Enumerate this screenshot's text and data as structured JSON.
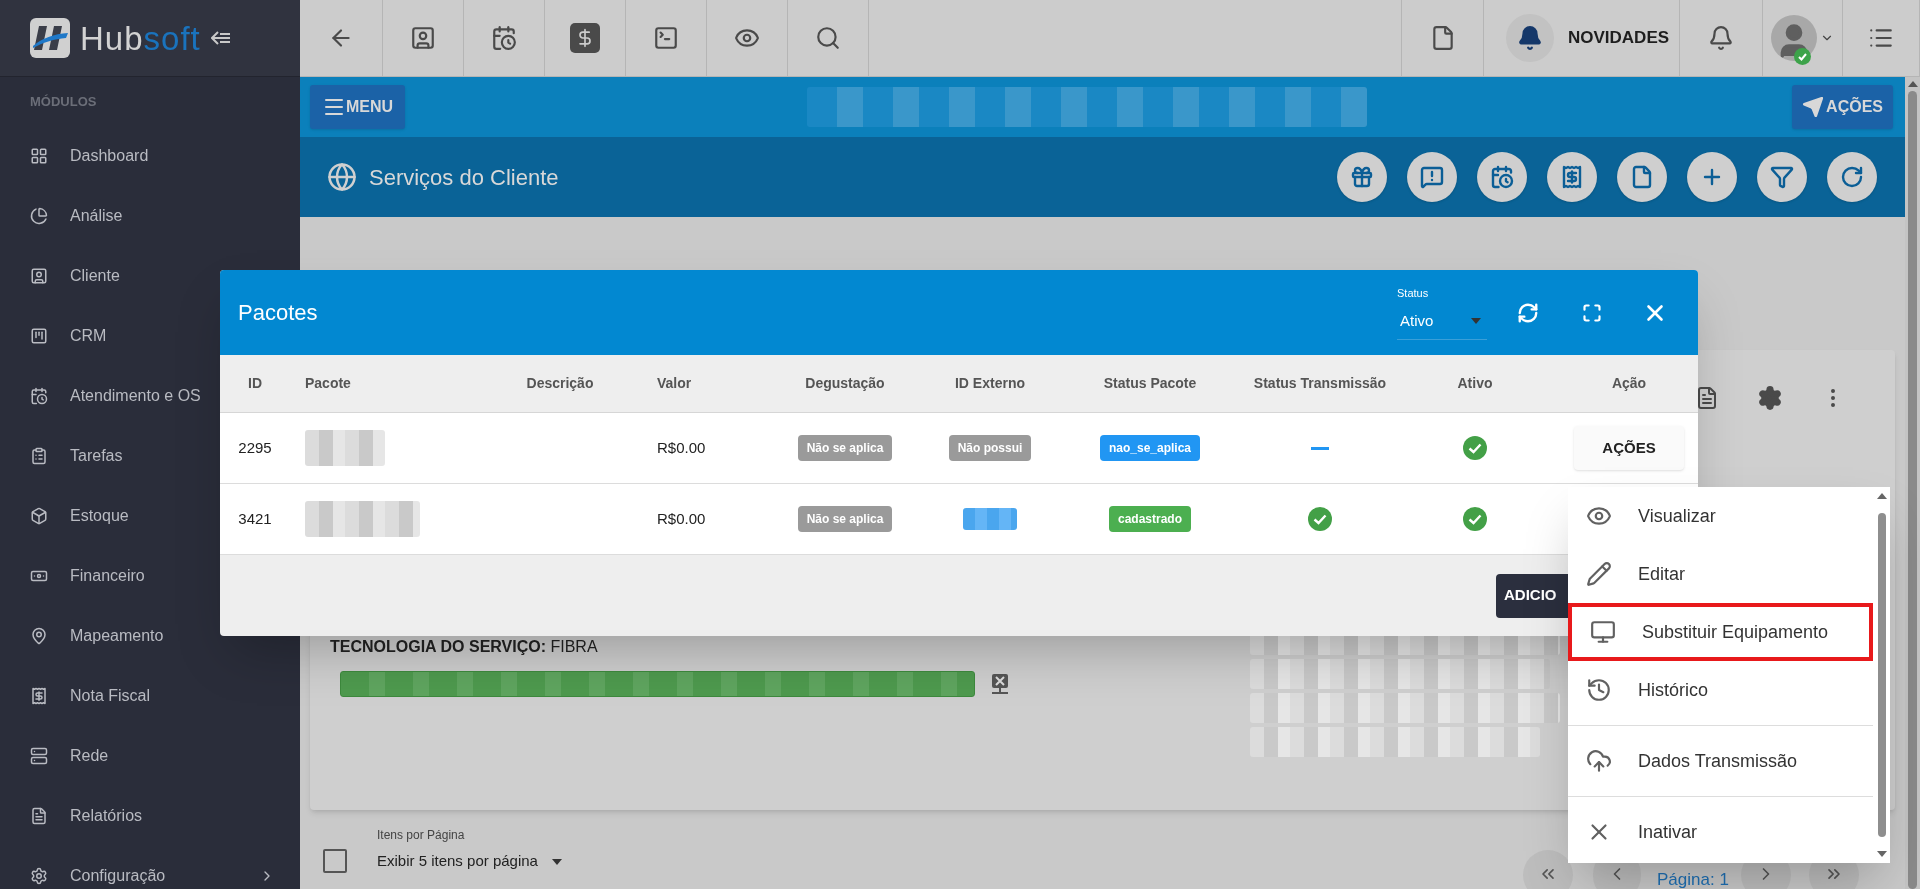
{
  "sidebar": {
    "brand_primary": "Hub",
    "brand_secondary": "soft",
    "section_title": "MÓDULOS",
    "items": [
      {
        "label": "Dashboard",
        "has_submenu": false
      },
      {
        "label": "Análise",
        "has_submenu": false
      },
      {
        "label": "Cliente"
      },
      {
        "label": "CRM"
      },
      {
        "label": "Atendimento e OS"
      },
      {
        "label": "Tarefas"
      },
      {
        "label": "Estoque"
      },
      {
        "label": "Financeiro"
      },
      {
        "label": "Mapeamento",
        "has_submenu": false
      },
      {
        "label": "Nota Fiscal",
        "has_submenu": false
      },
      {
        "label": "Rede",
        "has_submenu": false
      },
      {
        "label": "Relatórios",
        "has_submenu": false
      },
      {
        "label": "Configuração",
        "has_submenu": true
      }
    ]
  },
  "topbar": {
    "news_label": "NOVIDADES",
    "user_online": true
  },
  "action_bar": {
    "menu_button": "MENU",
    "actions_button": "AÇÕES"
  },
  "page_header": {
    "title": "Serviços do Cliente"
  },
  "service_card": {
    "technology": "**TECNOLOGIA DO SERVIÇO:** FIBRA"
  },
  "pagination_bar": {
    "select_all_checked": false,
    "page_size_label": "Itens por Página",
    "page_size_value": "Exibir 5 itens por página",
    "page_label": "Página: 1"
  },
  "modal": {
    "title": "Pacotes",
    "status_filter": {
      "label": "Status",
      "value": "Ativo"
    },
    "table": {
      "columns": [
        "ID",
        "Pacote",
        "Descrição",
        "Valor",
        "Degustação",
        "ID Externo",
        "Status Pacote",
        "Status Transmissão",
        "Ativo",
        "Ação"
      ],
      "rows": [
        {
          "id": "2295",
          "value": "R$0.00",
          "trial": "Não se aplica",
          "external_id": {
            "kind": "badge",
            "text": "Não possui"
          },
          "package_status": {
            "text": "nao_se_aplica",
            "color": "#2196f3"
          },
          "transmission_ok": false,
          "active": true,
          "action_button": "AÇÕES"
        },
        {
          "id": "3421",
          "value": "R$0.00",
          "trial": "Não se aplica",
          "external_id": {
            "kind": "redacted"
          },
          "package_status": {
            "text": "cadastrado",
            "color": "#4caf50"
          },
          "transmission_ok": true,
          "active": true
        }
      ]
    },
    "add_button": "ADICIO"
  },
  "actions_menu": {
    "items": [
      {
        "label": "Visualizar",
        "selected": false,
        "divider_before": false
      },
      {
        "label": "Editar",
        "selected": false,
        "divider_before": false
      },
      {
        "label": "Substituir Equipamento",
        "selected": true,
        "divider_before": false
      },
      {
        "label": "Histórico",
        "selected": false,
        "divider_before": false
      },
      {
        "label": "Dados Transmissão",
        "selected": false,
        "divider_before": true
      },
      {
        "label": "Inativar",
        "selected": false,
        "divider_before": true
      }
    ]
  }
}
